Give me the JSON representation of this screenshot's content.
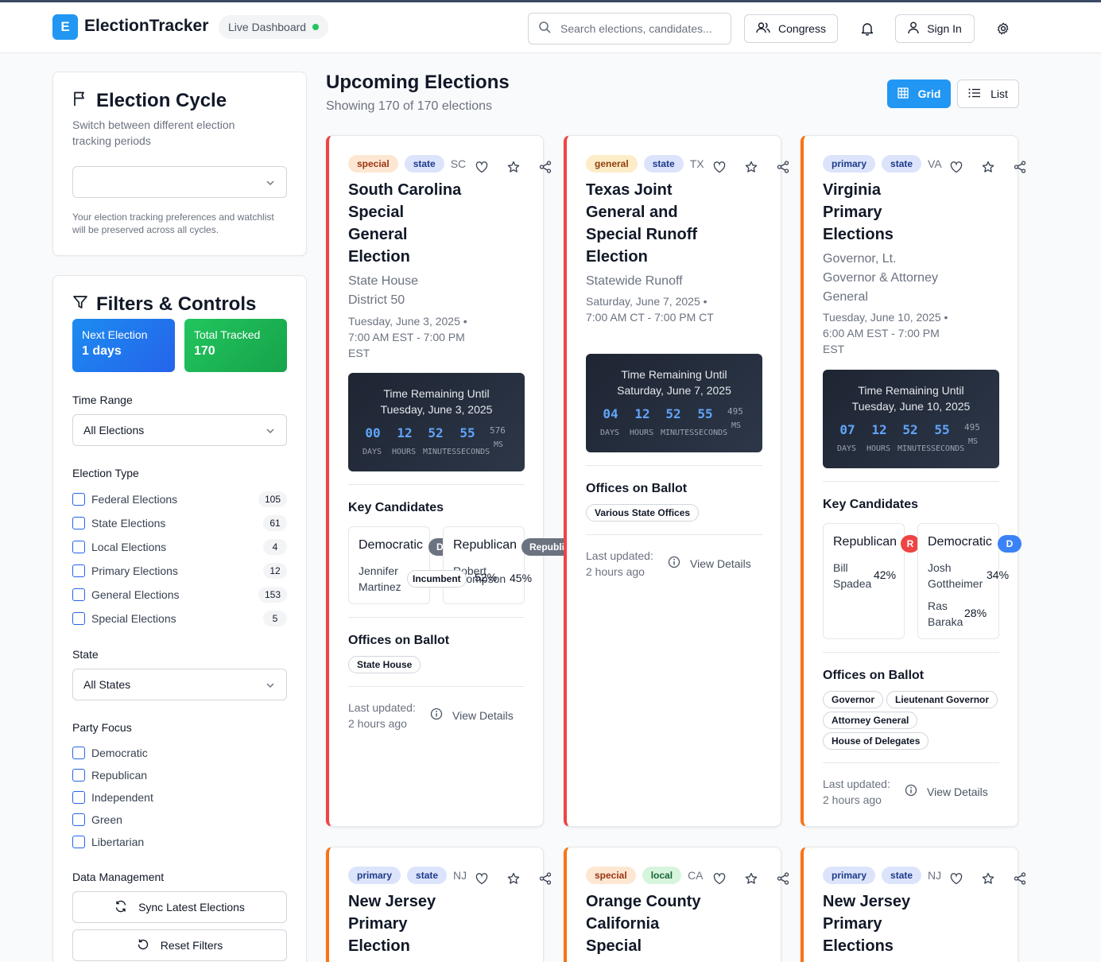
{
  "header": {
    "brand_letter": "E",
    "brand": "ElectionTracker",
    "live_label": "Live Dashboard",
    "search_placeholder": "Search elections, candidates...",
    "congress_label": "Congress",
    "sign_in_label": "Sign In",
    "icons": [
      "search-icon",
      "users-icon",
      "bell-icon",
      "user-icon",
      "gear-icon"
    ]
  },
  "cycle": {
    "title": "Election Cycle",
    "subtitle": "Switch between different election tracking periods",
    "select_value": "",
    "note": "Your election tracking preferences and watchlist will be preserved across all cycles."
  },
  "filters": {
    "title": "Filters & Controls",
    "next_election_label": "Next Election",
    "next_election_value": "1 days",
    "total_tracked_label": "Total Tracked",
    "total_tracked_value": "170",
    "time_range_label": "Time Range",
    "time_range_value": "All Elections",
    "election_type_label": "Election Type",
    "election_types": [
      {
        "label": "Federal Elections",
        "count": "105"
      },
      {
        "label": "State Elections",
        "count": "61"
      },
      {
        "label": "Local Elections",
        "count": "4"
      },
      {
        "label": "Primary Elections",
        "count": "12"
      },
      {
        "label": "General Elections",
        "count": "153"
      },
      {
        "label": "Special Elections",
        "count": "5"
      }
    ],
    "state_label": "State",
    "state_value": "All States",
    "party_label": "Party Focus",
    "parties": [
      "Democratic",
      "Republican",
      "Independent",
      "Green",
      "Libertarian"
    ],
    "data_label": "Data Management",
    "sync_label": "Sync Latest Elections",
    "reset_label": "Reset Filters"
  },
  "main": {
    "title": "Upcoming Elections",
    "subtitle": "Showing 170 of 170 elections",
    "grid_label": "Grid",
    "list_label": "List"
  },
  "labels": {
    "key_candidates": "Key Candidates",
    "offices": "Offices on Ballot",
    "last_updated": "Last updated:",
    "updated_ago": "2 hours ago",
    "view_details": "View Details",
    "days": "DAYS",
    "hours": "HOURS",
    "minutes": "MINUTES",
    "seconds": "SECONDS",
    "ms": "MS"
  },
  "cards": [
    {
      "type": "special",
      "level": "state",
      "state": "SC",
      "title": "South Carolina Special General Election",
      "subtitle": "State House District 50",
      "date": "Tuesday, June 3, 2025 • 7:00 AM EST - 7:00 PM EST",
      "timer_title": "Time Remaining Until Tuesday, June 3, 2025",
      "days": "00",
      "hours": "12",
      "minutes": "52",
      "seconds": "55",
      "ms": "576",
      "accent": "#ef4444",
      "candidates": [
        {
          "party": "Democratic",
          "tag": "Dem",
          "name1": "Jennifer",
          "name2": "Martinez",
          "incumbent": "Incumbent",
          "pct": "52%"
        },
        {
          "party": "Republican",
          "tag": "Republi",
          "name1": "Robert",
          "name2": "Thompson",
          "pct": "45%"
        }
      ],
      "offices": [
        "State House"
      ]
    },
    {
      "type": "general",
      "level": "state",
      "state": "TX",
      "title": "Texas Joint General and Special Runoff Election",
      "subtitle": "Statewide Runoff",
      "date": "Saturday, June 7, 2025 • 7:00 AM CT - 7:00 PM CT",
      "timer_title": "Time Remaining Until Saturday, June 7, 2025",
      "days": "04",
      "hours": "12",
      "minutes": "52",
      "seconds": "55",
      "ms": "495",
      "accent": "#ef4444",
      "offices": [
        "Various State Offices"
      ]
    },
    {
      "type": "primary",
      "level": "state",
      "state": "VA",
      "title": "Virginia Primary Elections",
      "subtitle": "Governor, Lt. Governor & Attorney General",
      "date": "Tuesday, June 10, 2025 • 6:00 AM EST - 7:00 PM EST",
      "timer_title": "Time Remaining Until Tuesday, June 10, 2025",
      "days": "07",
      "hours": "12",
      "minutes": "52",
      "seconds": "55",
      "ms": "495",
      "accent": "#f97316",
      "candidates": [
        {
          "party": "Republican",
          "tag": "R",
          "name1": "Bill",
          "name2": "Spadea",
          "pct": "42%"
        },
        {
          "party": "Democratic",
          "tag": "D",
          "name1": "Josh",
          "name2": "Gottheimer",
          "pct": "34%",
          "name3": "Ras",
          "name4": "Baraka",
          "pct2": "28%"
        }
      ],
      "offices": [
        "Governor",
        "Lieutenant Governor",
        "Attorney General",
        "House of Delegates"
      ]
    },
    {
      "type": "primary",
      "level": "state",
      "state": "NJ",
      "title": "New Jersey Primary Election",
      "accent": "#f97316"
    },
    {
      "type": "special",
      "level": "local",
      "state": "CA",
      "title": "Orange County California Special",
      "accent": "#f97316"
    },
    {
      "type": "primary",
      "level": "state",
      "state": "NJ",
      "title": "New Jersey Primary Elections",
      "accent": "#f97316"
    }
  ],
  "colors": {
    "brand": "#2196f3",
    "special_bg": "#fde7d2",
    "special_fg": "#9a3412",
    "general_bg": "#fdecc8",
    "general_fg": "#92400e",
    "primary_bg": "#dbe4fb",
    "primary_fg": "#1e3a8a",
    "state_bg": "#dbe4fb",
    "state_fg": "#1e3a8a",
    "local_bg": "#d7f5dd",
    "local_fg": "#166534",
    "democratic": "#3b82f6",
    "republican": "#ef4444"
  }
}
